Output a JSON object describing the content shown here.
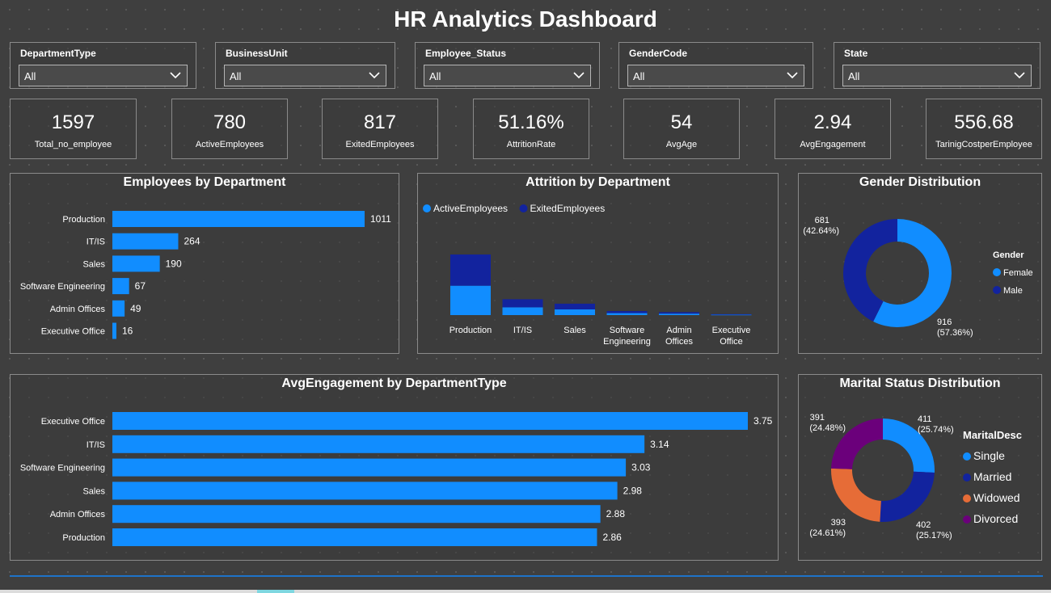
{
  "title": "HR Analytics Dashboard",
  "colors": {
    "primary": "#118dff",
    "secondary": "#12239e",
    "widowed": "#e66c37",
    "divorced": "#6b007b"
  },
  "slicers": [
    {
      "label": "DepartmentType",
      "value": "All"
    },
    {
      "label": "BusinessUnit",
      "value": "All"
    },
    {
      "label": "Employee_Status",
      "value": "All"
    },
    {
      "label": "GenderCode",
      "value": "All"
    },
    {
      "label": "State",
      "value": "All"
    }
  ],
  "kpis": [
    {
      "value": "1597",
      "label": "Total_no_employee"
    },
    {
      "value": "780",
      "label": "ActiveEmployees"
    },
    {
      "value": "817",
      "label": "ExitedEmployees"
    },
    {
      "value": "51.16%",
      "label": "AttritionRate"
    },
    {
      "value": "54",
      "label": "AvgAge"
    },
    {
      "value": "2.94",
      "label": "AvgEngagement"
    },
    {
      "value": "556.68",
      "label": "TarinigCostperEmployee"
    }
  ],
  "visual_titles": {
    "emp_by_dept": "Employees by Department",
    "attrition": "Attrition by Department",
    "gender": "Gender Distribution",
    "engagement": "AvgEngagement by DepartmentType",
    "marital": "Marital Status Distribution"
  },
  "chart_data": [
    {
      "type": "bar",
      "orientation": "horizontal",
      "title": "Employees by Department",
      "categories": [
        "Production",
        "IT/IS",
        "Sales",
        "Software Engineering",
        "Admin Offices",
        "Executive Office"
      ],
      "values": [
        1011,
        264,
        190,
        67,
        49,
        16
      ],
      "value_labels": [
        "1011",
        "264",
        "190",
        "67",
        "49",
        "16"
      ]
    },
    {
      "type": "bar",
      "stacked": true,
      "title": "Attrition by Department",
      "categories": [
        "Production",
        "IT/IS",
        "Sales",
        "Software Engineering",
        "Admin Offices",
        "Executive Office"
      ],
      "legend_position": "top-left",
      "series": [
        {
          "name": "ActiveEmployees",
          "color": "#118dff",
          "values": [
            490,
            130,
            95,
            33,
            24,
            8
          ]
        },
        {
          "name": "ExitedEmployees",
          "color": "#12239e",
          "values": [
            521,
            134,
            95,
            34,
            25,
            8
          ]
        }
      ]
    },
    {
      "type": "pie",
      "donut": true,
      "title": "Gender Distribution",
      "legend_title": "Gender",
      "legend_position": "right",
      "slices": [
        {
          "name": "Female",
          "value": 916,
          "label": "916",
          "pct_label": "(57.36%)",
          "color": "#118dff"
        },
        {
          "name": "Male",
          "value": 681,
          "label": "681",
          "pct_label": "(42.64%)",
          "color": "#12239e"
        }
      ]
    },
    {
      "type": "bar",
      "orientation": "horizontal",
      "title": "AvgEngagement by DepartmentType",
      "categories": [
        "Executive Office",
        "IT/IS",
        "Software Engineering",
        "Sales",
        "Admin Offices",
        "Production"
      ],
      "values": [
        3.75,
        3.14,
        3.03,
        2.98,
        2.88,
        2.86
      ],
      "value_labels": [
        "3.75",
        "3.14",
        "3.03",
        "2.98",
        "2.88",
        "2.86"
      ]
    },
    {
      "type": "pie",
      "donut": true,
      "title": "Marital Status Distribution",
      "legend_title": "MaritalDesc",
      "legend_position": "right",
      "slices": [
        {
          "name": "Single",
          "value": 411,
          "label": "411",
          "pct_label": "(25.74%)",
          "color": "#118dff"
        },
        {
          "name": "Married",
          "value": 402,
          "label": "402",
          "pct_label": "(25.17%)",
          "color": "#12239e"
        },
        {
          "name": "Widowed",
          "value": 393,
          "label": "393",
          "pct_label": "(24.61%)",
          "color": "#e66c37"
        },
        {
          "name": "Divorced",
          "value": 391,
          "label": "391",
          "pct_label": "(24.48%)",
          "color": "#6b007b"
        }
      ]
    }
  ]
}
